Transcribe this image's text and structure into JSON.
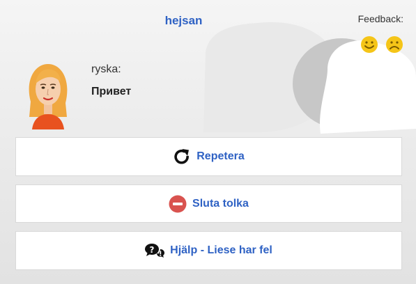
{
  "header": {
    "title": "hejsan",
    "feedback_label": "Feedback:"
  },
  "translation": {
    "language_label": "ryska:",
    "phrase": "Привет"
  },
  "buttons": {
    "repeat_label": "Repetera",
    "stop_label": "Sluta tolka",
    "help_label": "Hjälp - Liese har fel"
  },
  "icons": {
    "feedback_positive": "smiley-face-icon",
    "feedback_negative": "frowning-face-icon",
    "repeat": "redo-arrow-icon",
    "stop": "minus-circle-icon",
    "help": "question-speech-bubble-icon"
  },
  "colors": {
    "accent": "#2f62c4",
    "feedback_face": "#f5c518",
    "stop_icon": "#d9534f"
  }
}
